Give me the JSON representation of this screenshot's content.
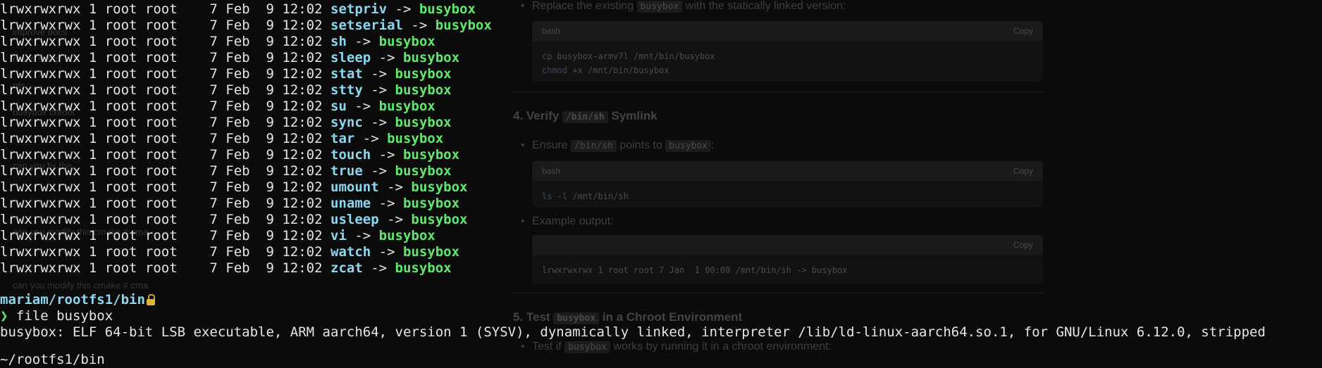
{
  "background_page": {
    "sidebar_items": [
      "improve docs",
      "rootfs setup",
      "nfs",
      "busybox chroot",
      "can you fix the",
      "can you modify this cmake # cma",
      "can you modify this cmake # cma"
    ],
    "step3_bullet": {
      "before": "Replace the existing",
      "code": "busybox",
      "after": "with the statically linked version:"
    },
    "code1": {
      "lang": "bash",
      "copy": "Copy",
      "line1_cmd": "cp",
      "line1_rest": " busybox-armv7l /mnt/bin/busybox",
      "line2_cmd": "chmod",
      "line2_rest": " +x /mnt/bin/busybox"
    },
    "step4_heading": {
      "prefix": "4. Verify",
      "code": "/bin/sh",
      "suffix": "Symlink"
    },
    "step4_bullet": {
      "before": "Ensure",
      "code1": "/bin/sh",
      "middle": "points to",
      "code2": "busybox",
      "after": ":"
    },
    "code2": {
      "lang": "bash",
      "copy": "Copy",
      "line1_cmd": "ls -l",
      "line1_rest": " /mnt/bin/sh"
    },
    "example_label": "Example output:",
    "code3": {
      "copy": "Copy",
      "line1": "lrwxrwxrwx 1 root root 7 Jan  1 00:00 /mnt/bin/sh -> busybox"
    },
    "step5_heading": {
      "prefix": "5. Test",
      "code": "busybox",
      "suffix": "in a Chroot Environment"
    },
    "step5_bullet": {
      "before": "Test if",
      "code": "busybox",
      "after": "works by running it in a chroot environment:"
    }
  },
  "terminal": {
    "ls_rows": [
      {
        "perms": "lrwxrwxrwx 1 root root    7 Feb  9 12:02 ",
        "name": "setpriv",
        "arrow": " -> ",
        "target": "busybox"
      },
      {
        "perms": "lrwxrwxrwx 1 root root    7 Feb  9 12:02 ",
        "name": "setserial",
        "arrow": " -> ",
        "target": "busybox"
      },
      {
        "perms": "lrwxrwxrwx 1 root root    7 Feb  9 12:02 ",
        "name": "sh",
        "arrow": " -> ",
        "target": "busybox"
      },
      {
        "perms": "lrwxrwxrwx 1 root root    7 Feb  9 12:02 ",
        "name": "sleep",
        "arrow": " -> ",
        "target": "busybox"
      },
      {
        "perms": "lrwxrwxrwx 1 root root    7 Feb  9 12:02 ",
        "name": "stat",
        "arrow": " -> ",
        "target": "busybox"
      },
      {
        "perms": "lrwxrwxrwx 1 root root    7 Feb  9 12:02 ",
        "name": "stty",
        "arrow": " -> ",
        "target": "busybox"
      },
      {
        "perms": "lrwxrwxrwx 1 root root    7 Feb  9 12:02 ",
        "name": "su",
        "arrow": " -> ",
        "target": "busybox"
      },
      {
        "perms": "lrwxrwxrwx 1 root root    7 Feb  9 12:02 ",
        "name": "sync",
        "arrow": " -> ",
        "target": "busybox"
      },
      {
        "perms": "lrwxrwxrwx 1 root root    7 Feb  9 12:02 ",
        "name": "tar",
        "arrow": " -> ",
        "target": "busybox"
      },
      {
        "perms": "lrwxrwxrwx 1 root root    7 Feb  9 12:02 ",
        "name": "touch",
        "arrow": " -> ",
        "target": "busybox"
      },
      {
        "perms": "lrwxrwxrwx 1 root root    7 Feb  9 12:02 ",
        "name": "true",
        "arrow": " -> ",
        "target": "busybox"
      },
      {
        "perms": "lrwxrwxrwx 1 root root    7 Feb  9 12:02 ",
        "name": "umount",
        "arrow": " -> ",
        "target": "busybox"
      },
      {
        "perms": "lrwxrwxrwx 1 root root    7 Feb  9 12:02 ",
        "name": "uname",
        "arrow": " -> ",
        "target": "busybox"
      },
      {
        "perms": "lrwxrwxrwx 1 root root    7 Feb  9 12:02 ",
        "name": "usleep",
        "arrow": " -> ",
        "target": "busybox"
      },
      {
        "perms": "lrwxrwxrwx 1 root root    7 Feb  9 12:02 ",
        "name": "vi",
        "arrow": " -> ",
        "target": "busybox"
      },
      {
        "perms": "lrwxrwxrwx 1 root root    7 Feb  9 12:02 ",
        "name": "watch",
        "arrow": " -> ",
        "target": "busybox"
      },
      {
        "perms": "lrwxrwxrwx 1 root root    7 Feb  9 12:02 ",
        "name": "zcat",
        "arrow": " -> ",
        "target": "busybox"
      }
    ],
    "prompt_path": "mariam/rootfs1/bin",
    "prompt_symbol": "❯",
    "command": " file busybox",
    "output": "busybox: ELF 64-bit LSB executable, ARM aarch64, version 1 (SYSV), dynamically linked, interpreter /lib/ld-linux-aarch64.so.1, for GNU/Linux 6.12.0, stripped",
    "next_line": "~/rootfs1/bin"
  },
  "colors": {
    "background": "#0b0b0b",
    "text": "#e6e6e6",
    "directory_cyan": "#8ad8f0",
    "link_target_green": "#5fe86a",
    "lock_icon": "#e0b23a"
  }
}
